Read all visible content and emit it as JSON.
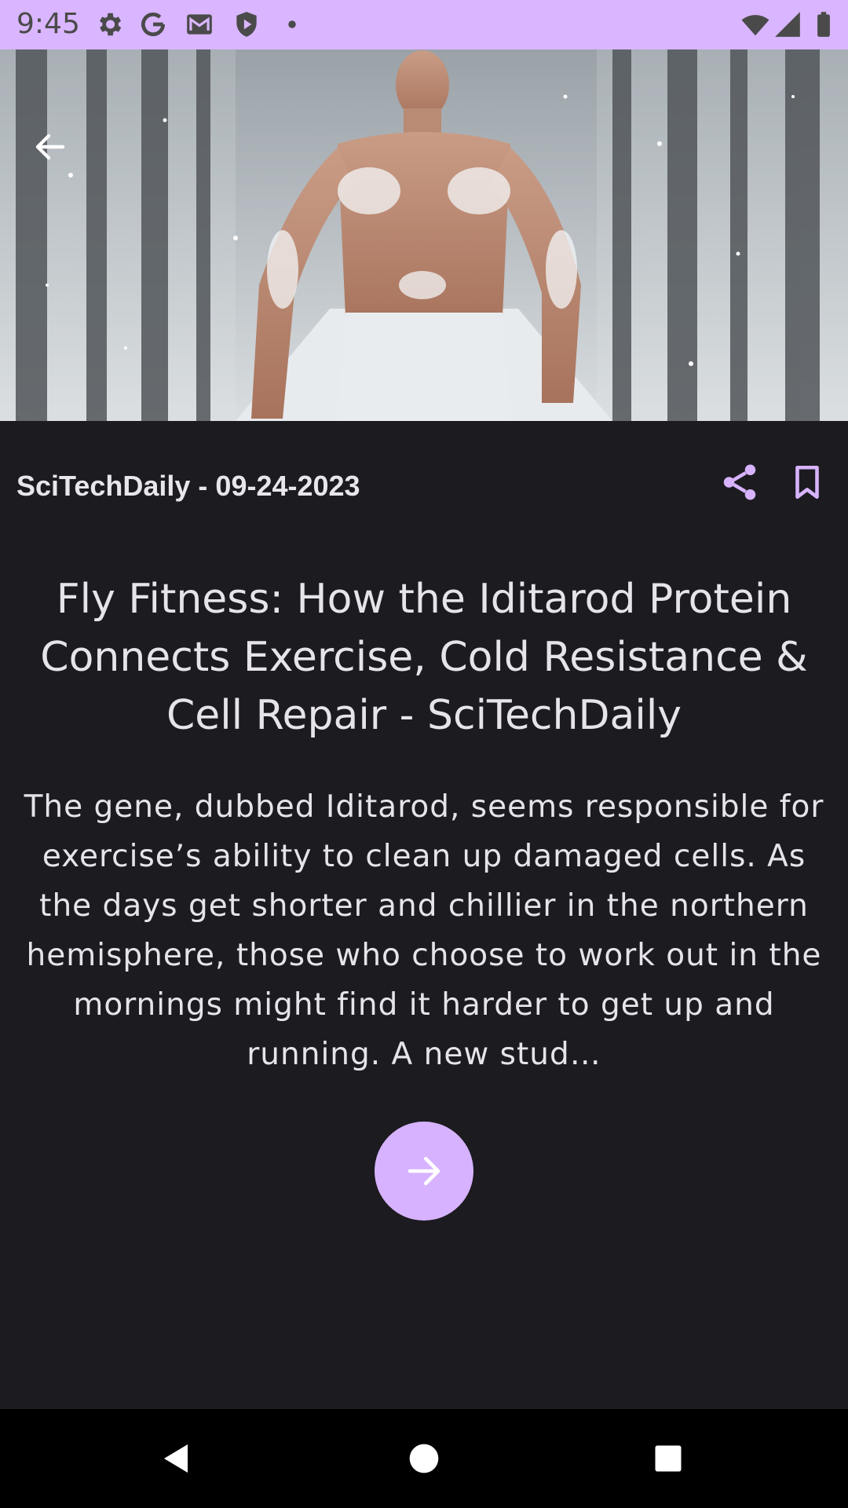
{
  "status_bar": {
    "time": "9:45",
    "left_icons": [
      "gear-icon",
      "google-icon",
      "gmail-icon",
      "shield-play-icon",
      "dot-icon"
    ],
    "right_icons": [
      "wifi-icon",
      "signal-icon",
      "battery-icon"
    ]
  },
  "article": {
    "source_date": "SciTechDaily - 09-24-2023",
    "title": "Fly Fitness: How the Iditarod Protein Connects Exercise, Cold Resistance & Cell Repair - SciTechDaily",
    "description": "The gene, dubbed Iditarod, seems responsible for exercise’s ability to clean up damaged cells. As the days get shorter and chillier in the northern hemisphere, those who choose to work out in the mornings might find it harder to get up and running. A new stud…"
  },
  "colors": {
    "accent": "#d7b3ff",
    "status_bar_bg": "#d9b6ff",
    "background": "#1c1b20",
    "text": "#e6e4ea"
  },
  "icons": {
    "back": "arrow-left-icon",
    "share": "share-icon",
    "bookmark": "bookmark-icon",
    "read_more": "arrow-right-icon",
    "nav": [
      "back-triangle-icon",
      "home-circle-icon",
      "recents-square-icon"
    ]
  }
}
